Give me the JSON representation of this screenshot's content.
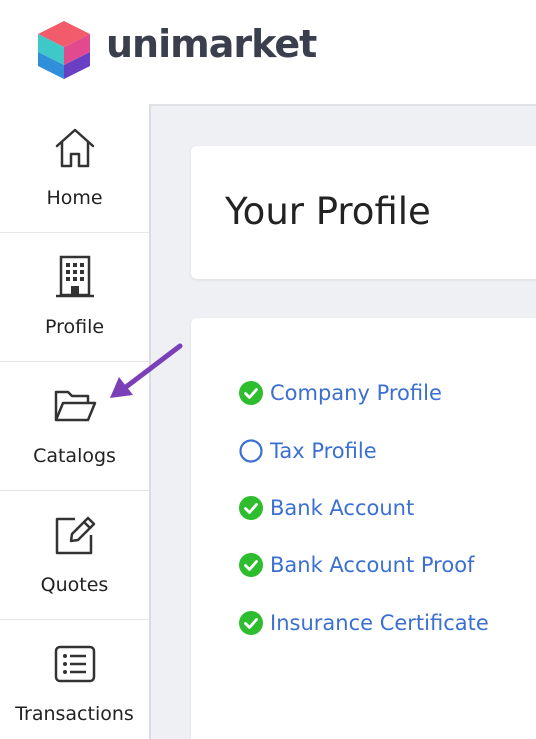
{
  "brand": {
    "name": "unimarket"
  },
  "sidebar": {
    "items": [
      {
        "label": "Home",
        "icon": "home-icon"
      },
      {
        "label": "Profile",
        "icon": "building-icon"
      },
      {
        "label": "Catalogs",
        "icon": "folder-open-icon"
      },
      {
        "label": "Quotes",
        "icon": "edit-icon"
      },
      {
        "label": "Transactions",
        "icon": "list-icon"
      }
    ]
  },
  "main": {
    "title": "Your Profile",
    "checklist": [
      {
        "label": "Company Profile",
        "status": "complete"
      },
      {
        "label": "Tax Profile",
        "status": "incomplete"
      },
      {
        "label": "Bank Account",
        "status": "complete"
      },
      {
        "label": "Bank Account Proof",
        "status": "complete"
      },
      {
        "label": "Insurance Certificate",
        "status": "complete"
      }
    ]
  },
  "annotation": {
    "arrow_color": "#7b3fb8",
    "points_to": "Catalogs"
  },
  "colors": {
    "link": "#3b6fd2",
    "check": "#2ebd2e",
    "outline": "#3b6fd2"
  }
}
